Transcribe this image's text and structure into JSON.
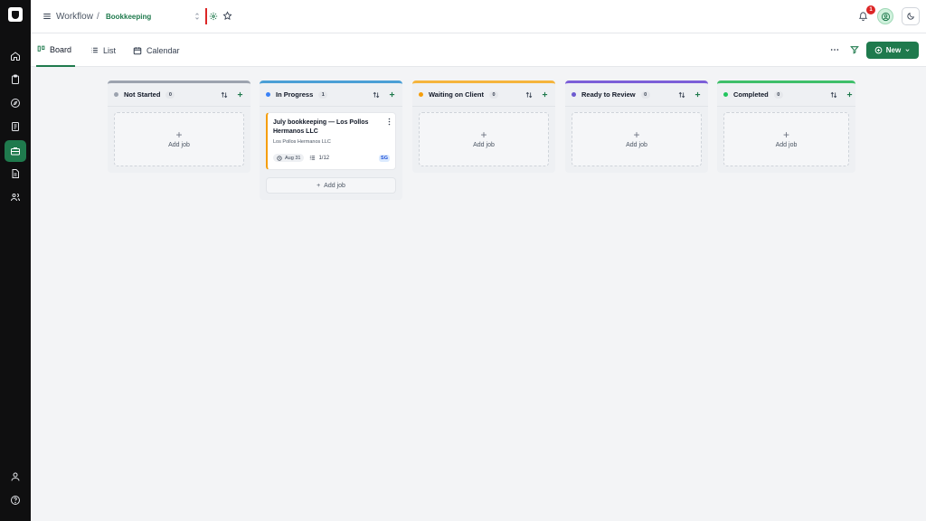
{
  "breadcrumb": {
    "root": "Workflow",
    "separator": "/",
    "current": "Bookkeeping"
  },
  "header": {
    "notification_count": "1"
  },
  "views": {
    "tabs": [
      {
        "label": "Board",
        "icon": "board-icon",
        "active": true
      },
      {
        "label": "List",
        "icon": "list-icon",
        "active": false
      },
      {
        "label": "Calendar",
        "icon": "calendar-icon",
        "active": false
      }
    ],
    "new_label": "New"
  },
  "sidebar": {
    "items": [
      {
        "icon": "home-icon"
      },
      {
        "icon": "clipboard-icon"
      },
      {
        "icon": "compass-icon"
      },
      {
        "icon": "document-list-icon"
      },
      {
        "icon": "briefcase-icon",
        "active": true
      },
      {
        "icon": "file-text-icon"
      },
      {
        "icon": "users-icon"
      }
    ],
    "bottom": [
      {
        "icon": "user-icon"
      },
      {
        "icon": "help-icon"
      }
    ]
  },
  "board": {
    "add_job_label": "Add job",
    "add_job_plus": "+",
    "columns": [
      {
        "name": "Not Started",
        "count": "0",
        "color": "#9ca3af",
        "bar": "#9ca3af"
      },
      {
        "name": "In Progress",
        "count": "1",
        "color": "#3b82f6",
        "bar": "#4b9fd6"
      },
      {
        "name": "Waiting on Client",
        "count": "0",
        "color": "#f59e0b",
        "bar": "#f5b43c"
      },
      {
        "name": "Ready to Review",
        "count": "0",
        "color": "#6d5bd0",
        "bar": "#7c5fd8"
      },
      {
        "name": "Completed",
        "count": "0",
        "color": "#22c55e",
        "bar": "#3fbf6a"
      }
    ],
    "job": {
      "title": "July bookkeeping — Los Pollos Hermanos LLC",
      "client": "Los Pollos Hermanos LLC",
      "due": "Aug 31",
      "subtasks": "1/12",
      "assignee": "SG"
    }
  }
}
